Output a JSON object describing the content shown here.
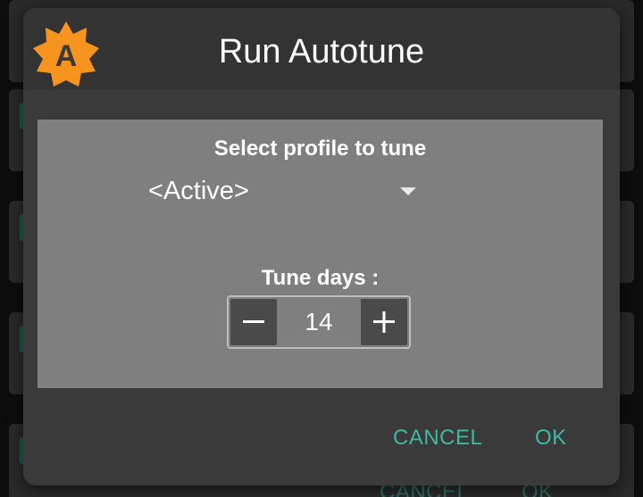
{
  "background": {
    "cancel_label": "CANCEL",
    "ok_label": "OK"
  },
  "dialog": {
    "title": "Run Autotune",
    "app_icon_letter": "A",
    "profile_label": "Select profile to tune",
    "profile_selected": "<Active>",
    "tune_days_label": "Tune days :",
    "tune_days_value": "14",
    "cancel_label": "CANCEL",
    "ok_label": "OK"
  },
  "colors": {
    "accent": "#3fb8a1",
    "icon_orange": "#f7941d",
    "panel": "#7f7f7f",
    "dialog": "#3a3a3a"
  }
}
